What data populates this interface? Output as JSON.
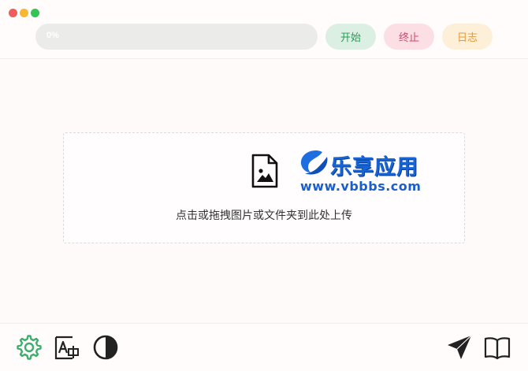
{
  "window": {
    "controls": [
      "close",
      "minimize",
      "maximize"
    ]
  },
  "toolbar": {
    "progress_text": "0%",
    "progress_value": 0,
    "start_label": "开始",
    "stop_label": "终止",
    "log_label": "日志"
  },
  "dropzone": {
    "icon": "image-file-icon",
    "text": "点击或拖拽图片或文件夹到此处上传"
  },
  "watermark": {
    "title": "乐享应用",
    "url": "www.vbbbs.com"
  },
  "bottom_toolbar": {
    "left_icons": [
      "settings-icon",
      "font-icon",
      "theme-contrast-icon"
    ],
    "right_icons": [
      "send-icon",
      "book-icon"
    ]
  },
  "colors": {
    "start": "#2b9b5a",
    "stop": "#d2476a",
    "log": "#e39a3a",
    "icon_green": "#3cae6e"
  }
}
